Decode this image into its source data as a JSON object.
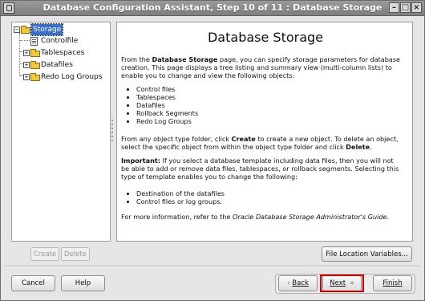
{
  "window": {
    "title": "Database Configuration Assistant, Step 10 of 11 : Database Storage",
    "buttons": {
      "minimize": "–",
      "maximize": "□",
      "close": "×"
    }
  },
  "tree": {
    "root": "Storage",
    "items": [
      "Controlfile",
      "Tablespaces",
      "Datafiles",
      "Redo Log Groups"
    ]
  },
  "content": {
    "heading": "Database Storage",
    "intro": {
      "prefix": "From the ",
      "page_name": "Database Storage",
      "suffix": " page, you can specify storage parameters for database creation. This page displays a tree listing and summary view (multi-column lists) to enable you to change and view the following objects:"
    },
    "objects": [
      "Control files",
      "Tablespaces",
      "Datafiles",
      "Rollback Segments",
      "Redo Log Groups"
    ],
    "create_delete": {
      "text1": "From any object type folder, click ",
      "create": "Create",
      "text2": " to create a new object. To delete an object, select the specific object from within the object type folder and click ",
      "delete": "Delete",
      "text3": "."
    },
    "important": {
      "label": "Important:",
      "text": " If you select a database template including data files, then you will not be able to add or remove data files, tablespaces, or rollback segments. Selecting this type of template enables you to change the following:"
    },
    "changeables": [
      "Destination of the datafiles",
      "Control files or log groups."
    ],
    "more_info": {
      "prefix": "For more information, refer to the ",
      "guide": "Oracle Database Storage Administrator's Guide",
      "suffix": "."
    }
  },
  "actions": {
    "create": "Create",
    "delete": "Delete",
    "file_location": "File Location Variables..."
  },
  "footer": {
    "cancel": "Cancel",
    "help": "Help",
    "back": "Back",
    "next": "Next",
    "finish": "Finish",
    "back_arrow": "‹",
    "next_arrow": "»"
  }
}
